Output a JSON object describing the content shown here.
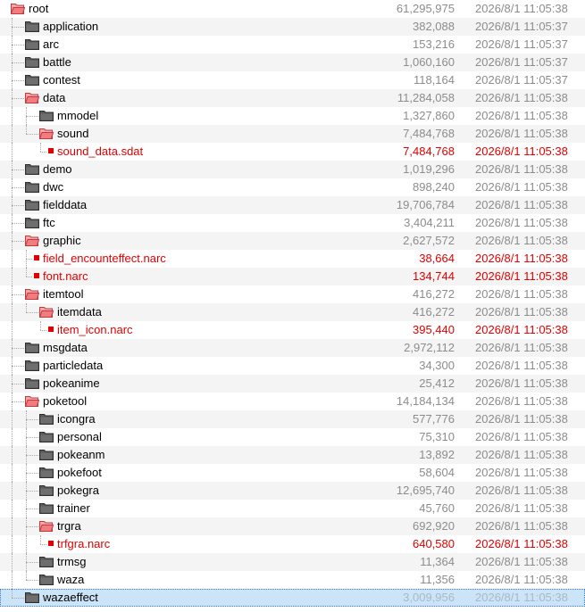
{
  "tree": {
    "rows": [
      {
        "name": "root",
        "size": "61,295,975",
        "date": "2026/8/1 11:05:38",
        "depth": 0,
        "type": "folder-open"
      },
      {
        "name": "application",
        "size": "382,088",
        "date": "2026/8/1 11:05:37",
        "depth": 1,
        "type": "folder"
      },
      {
        "name": "arc",
        "size": "153,216",
        "date": "2026/8/1 11:05:37",
        "depth": 1,
        "type": "folder"
      },
      {
        "name": "battle",
        "size": "1,060,160",
        "date": "2026/8/1 11:05:37",
        "depth": 1,
        "type": "folder"
      },
      {
        "name": "contest",
        "size": "118,164",
        "date": "2026/8/1 11:05:37",
        "depth": 1,
        "type": "folder"
      },
      {
        "name": "data",
        "size": "11,284,058",
        "date": "2026/8/1 11:05:38",
        "depth": 1,
        "type": "folder-open"
      },
      {
        "name": "mmodel",
        "size": "1,327,860",
        "date": "2026/8/1 11:05:38",
        "depth": 2,
        "type": "folder"
      },
      {
        "name": "sound",
        "size": "7,484,768",
        "date": "2026/8/1 11:05:38",
        "depth": 2,
        "type": "folder-open"
      },
      {
        "name": "sound_data.sdat",
        "size": "7,484,768",
        "date": "2026/8/1 11:05:38",
        "depth": 3,
        "type": "file"
      },
      {
        "name": "demo",
        "size": "1,019,296",
        "date": "2026/8/1 11:05:38",
        "depth": 1,
        "type": "folder"
      },
      {
        "name": "dwc",
        "size": "898,240",
        "date": "2026/8/1 11:05:38",
        "depth": 1,
        "type": "folder"
      },
      {
        "name": "fielddata",
        "size": "19,706,784",
        "date": "2026/8/1 11:05:38",
        "depth": 1,
        "type": "folder"
      },
      {
        "name": "ftc",
        "size": "3,404,211",
        "date": "2026/8/1 11:05:38",
        "depth": 1,
        "type": "folder"
      },
      {
        "name": "graphic",
        "size": "2,627,572",
        "date": "2026/8/1 11:05:38",
        "depth": 1,
        "type": "folder-open"
      },
      {
        "name": "field_encounteffect.narc",
        "size": "38,664",
        "date": "2026/8/1 11:05:38",
        "depth": 2,
        "type": "file"
      },
      {
        "name": "font.narc",
        "size": "134,744",
        "date": "2026/8/1 11:05:38",
        "depth": 2,
        "type": "file"
      },
      {
        "name": "itemtool",
        "size": "416,272",
        "date": "2026/8/1 11:05:38",
        "depth": 1,
        "type": "folder-open"
      },
      {
        "name": "itemdata",
        "size": "416,272",
        "date": "2026/8/1 11:05:38",
        "depth": 2,
        "type": "folder-open"
      },
      {
        "name": "item_icon.narc",
        "size": "395,440",
        "date": "2026/8/1 11:05:38",
        "depth": 3,
        "type": "file"
      },
      {
        "name": "msgdata",
        "size": "2,972,112",
        "date": "2026/8/1 11:05:38",
        "depth": 1,
        "type": "folder"
      },
      {
        "name": "particledata",
        "size": "34,300",
        "date": "2026/8/1 11:05:38",
        "depth": 1,
        "type": "folder"
      },
      {
        "name": "pokeanime",
        "size": "25,412",
        "date": "2026/8/1 11:05:38",
        "depth": 1,
        "type": "folder"
      },
      {
        "name": "poketool",
        "size": "14,184,134",
        "date": "2026/8/1 11:05:38",
        "depth": 1,
        "type": "folder-open"
      },
      {
        "name": "icongra",
        "size": "577,776",
        "date": "2026/8/1 11:05:38",
        "depth": 2,
        "type": "folder"
      },
      {
        "name": "personal",
        "size": "75,310",
        "date": "2026/8/1 11:05:38",
        "depth": 2,
        "type": "folder"
      },
      {
        "name": "pokeanm",
        "size": "13,892",
        "date": "2026/8/1 11:05:38",
        "depth": 2,
        "type": "folder"
      },
      {
        "name": "pokefoot",
        "size": "58,604",
        "date": "2026/8/1 11:05:38",
        "depth": 2,
        "type": "folder"
      },
      {
        "name": "pokegra",
        "size": "12,695,740",
        "date": "2026/8/1 11:05:38",
        "depth": 2,
        "type": "folder"
      },
      {
        "name": "trainer",
        "size": "45,760",
        "date": "2026/8/1 11:05:38",
        "depth": 2,
        "type": "folder"
      },
      {
        "name": "trgra",
        "size": "692,920",
        "date": "2026/8/1 11:05:38",
        "depth": 2,
        "type": "folder-open"
      },
      {
        "name": "trfgra.narc",
        "size": "640,580",
        "date": "2026/8/1 11:05:38",
        "depth": 3,
        "type": "file"
      },
      {
        "name": "trmsg",
        "size": "11,364",
        "date": "2026/8/1 11:05:38",
        "depth": 2,
        "type": "folder"
      },
      {
        "name": "waza",
        "size": "11,356",
        "date": "2026/8/1 11:05:38",
        "depth": 2,
        "type": "folder"
      },
      {
        "name": "wazaeffect",
        "size": "3,009,956",
        "date": "2026/8/1 11:05:38",
        "depth": 1,
        "type": "folder",
        "selected": true
      }
    ]
  },
  "icons": {
    "folder": "folder-icon",
    "folder-open": "folder-open-icon",
    "file": "file-icon"
  },
  "colors": {
    "file_text": "#e00000",
    "folder_closed": "#555555",
    "folder_open": "#e8777b",
    "selection": "#cce4f7",
    "muted_text": "#8c8c8c"
  }
}
